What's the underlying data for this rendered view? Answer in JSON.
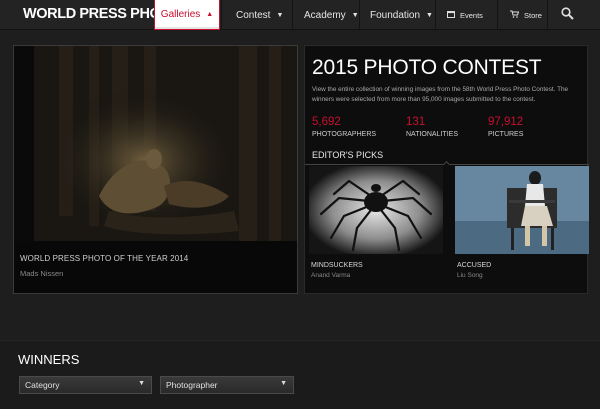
{
  "nav": {
    "logo": "WORLD PRESS PHOTO",
    "items": [
      {
        "label": "Galleries",
        "icon": "chevron-up-icon"
      },
      {
        "label": "Contest",
        "icon": "chevron-down-icon"
      },
      {
        "label": "Academy",
        "icon": "chevron-down-icon"
      },
      {
        "label": "Foundation",
        "icon": "chevron-down-icon"
      },
      {
        "label": "Events",
        "icon": "calendar-icon"
      },
      {
        "label": "Store",
        "icon": "cart-icon"
      }
    ],
    "search_icon": "search-icon",
    "accent": "#c8102e"
  },
  "hero": {
    "title": "WORLD PRESS PHOTO OF THE YEAR 2014",
    "author": "Mads Nissen"
  },
  "contest": {
    "title": "2015 PHOTO CONTEST",
    "intro": "View the entire collection of winning images from the 58th World Press Photo Contest. The winners were selected from more than 95,000 images submitted to the contest.",
    "stats": [
      {
        "value": "5,692",
        "label": "PHOTOGRAPHERS"
      },
      {
        "value": "131",
        "label": "NATIONALITIES"
      },
      {
        "value": "97,912",
        "label": "PICTURES"
      }
    ],
    "picks_heading": "EDITOR'S PICKS",
    "picks": [
      {
        "title": "MINDSUCKERS",
        "author": "Anand Varma"
      },
      {
        "title": "ACCUSED",
        "author": "Liu Song"
      }
    ]
  },
  "winners": {
    "heading": "WINNERS",
    "filters": [
      {
        "value": "Category"
      },
      {
        "value": "Photographer"
      }
    ]
  }
}
